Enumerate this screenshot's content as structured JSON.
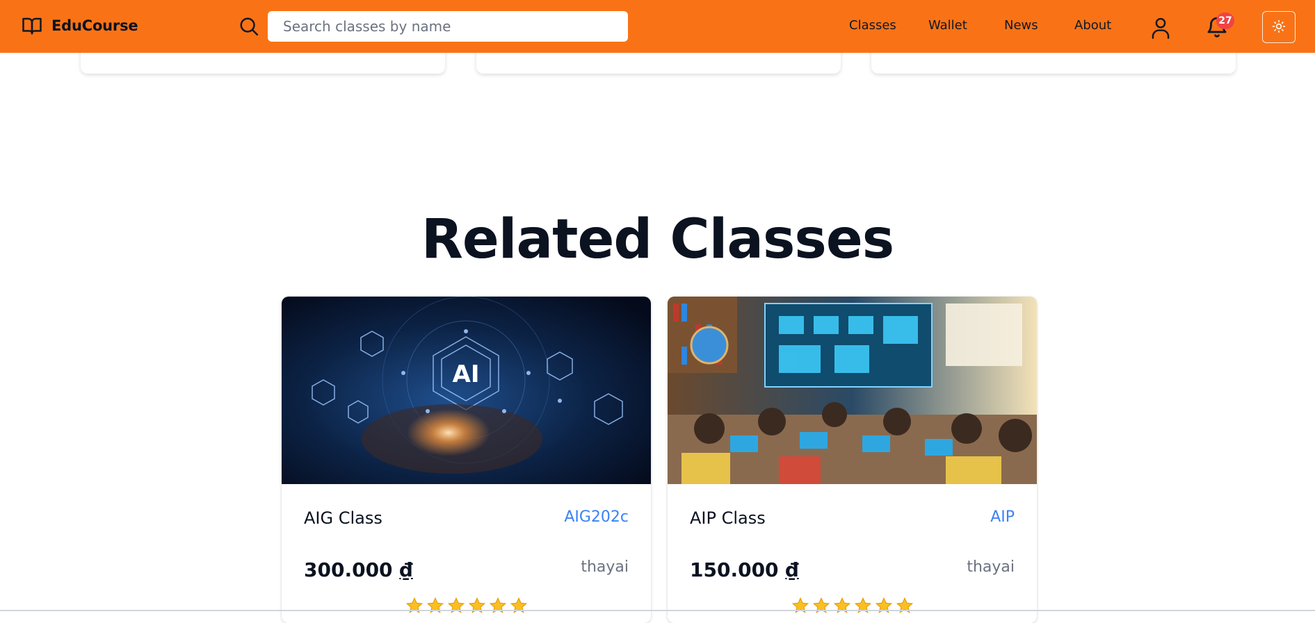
{
  "header": {
    "brand": "EduCourse",
    "search": {
      "placeholder": "Search classes by name",
      "value": ""
    },
    "nav": [
      "Classes",
      "Wallet",
      "News",
      "About"
    ],
    "notification_count": "27",
    "icons": [
      "book-open-icon",
      "search-icon",
      "user-icon",
      "bell-icon",
      "sun-icon"
    ],
    "colors": {
      "bar": "#f97316",
      "badge": "#ef4444",
      "link_accent": "#3b82f6"
    }
  },
  "main": {
    "section_title": "Related Classes",
    "classes": [
      {
        "name": "AIG Class",
        "code": "AIG202c",
        "price": "300.000",
        "currency": "₫",
        "teacher": "thayai",
        "rating": 6
      },
      {
        "name": "AIP Class",
        "code": "AIP",
        "price": "150.000",
        "currency": "₫",
        "teacher": "thayai",
        "rating": 6
      }
    ]
  }
}
